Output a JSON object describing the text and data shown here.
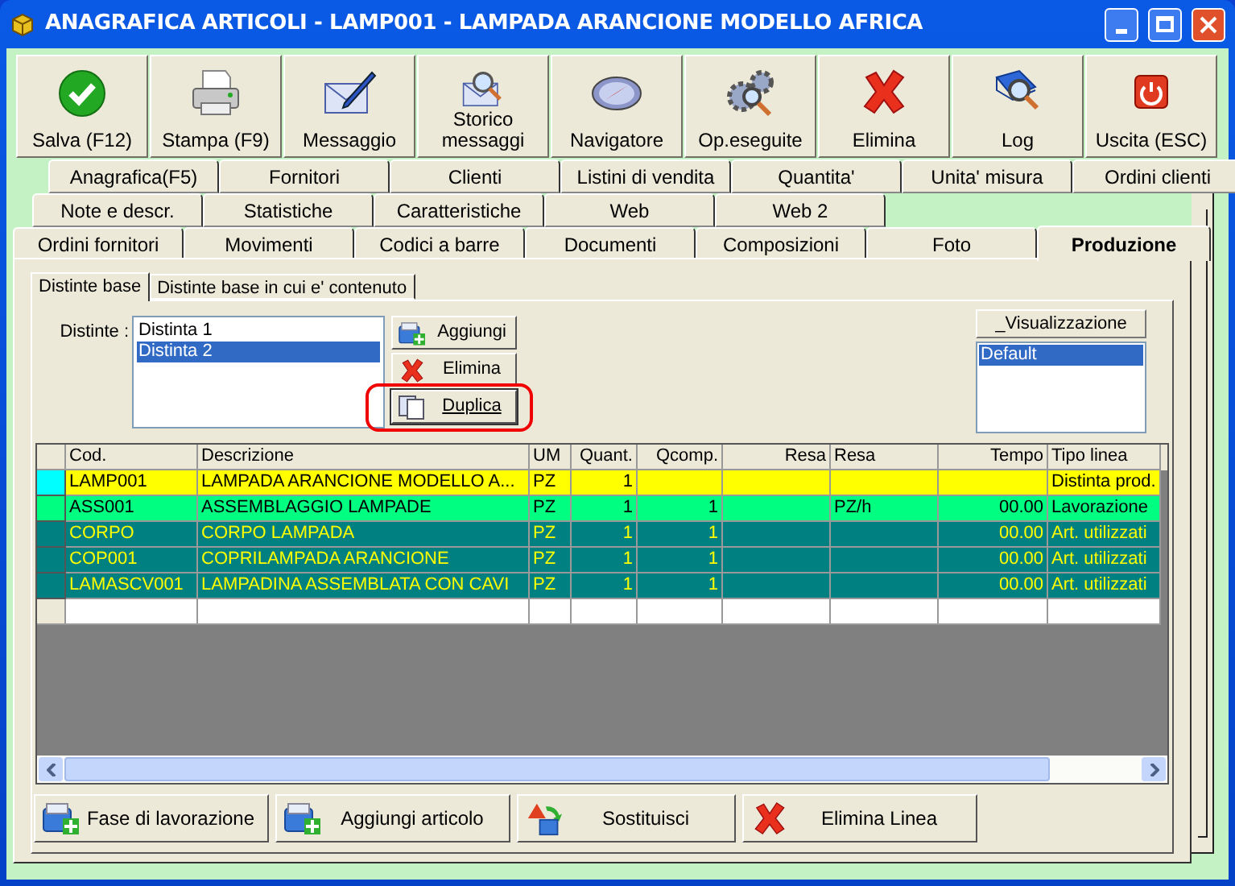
{
  "window": {
    "title": "ANAGRAFICA ARTICOLI - LAMP001 - LAMPADA ARANCIONE MODELLO AFRICA"
  },
  "toolbar": [
    {
      "kind": "check",
      "label": "Salva (F12)"
    },
    {
      "kind": "printer",
      "label": "Stampa (F9)"
    },
    {
      "kind": "pen",
      "label": "Messaggio"
    },
    {
      "kind": "history",
      "label": "Storico messaggi"
    },
    {
      "kind": "compass",
      "label": "Navigatore"
    },
    {
      "kind": "gears",
      "label": "Op.eseguite"
    },
    {
      "kind": "delete",
      "label": "Elimina"
    },
    {
      "kind": "log",
      "label": "Log"
    },
    {
      "kind": "power",
      "label": "Uscita (ESC)"
    }
  ],
  "tab_rows": [
    [
      {
        "label": "Anagrafica(F5)",
        "selected": false
      },
      {
        "label": "Fornitori",
        "selected": false
      },
      {
        "label": "Clienti",
        "selected": false
      },
      {
        "label": "Listini di vendita",
        "selected": false
      },
      {
        "label": "Quantita'",
        "selected": false
      },
      {
        "label": "Unita' misura",
        "selected": false
      },
      {
        "label": "Ordini clienti",
        "selected": false
      }
    ],
    [
      {
        "label": "Note e descr.",
        "selected": false
      },
      {
        "label": "Statistiche",
        "selected": false
      },
      {
        "label": "Caratteristiche",
        "selected": false
      },
      {
        "label": "Web",
        "selected": false
      },
      {
        "label": "Web 2",
        "selected": false
      }
    ],
    [
      {
        "label": "Ordini fornitori",
        "selected": false
      },
      {
        "label": "Movimenti",
        "selected": false
      },
      {
        "label": "Codici a barre",
        "selected": false
      },
      {
        "label": "Documenti",
        "selected": false
      },
      {
        "label": "Composizioni",
        "selected": false
      },
      {
        "label": "Foto",
        "selected": false
      },
      {
        "label": "Produzione",
        "selected": true
      }
    ]
  ],
  "sub_tabs": [
    {
      "label": "Distinte base",
      "selected": true
    },
    {
      "label": "Distinte base in cui e' contenuto",
      "selected": false
    }
  ],
  "distinte": {
    "label": "Distinte :",
    "items": [
      {
        "label": "Distinta 1",
        "selected": false
      },
      {
        "label": "Distinta 2",
        "selected": true
      }
    ]
  },
  "distinte_buttons": [
    {
      "kind": "add",
      "label": "Aggiungi",
      "highlighted": false
    },
    {
      "kind": "delete",
      "label": "Elimina",
      "highlighted": false
    },
    {
      "kind": "copy",
      "label": "Duplica",
      "highlighted": true
    }
  ],
  "visualizzazione": {
    "header": "_Visualizzazione",
    "items": [
      {
        "label": "Default",
        "selected": true
      }
    ]
  },
  "table": {
    "columns": [
      "Cod.",
      "Descrizione",
      "UM",
      "Quant.",
      "Qcomp.",
      "Resa",
      "Resa",
      "Tempo",
      "Tipo linea"
    ],
    "rows": [
      {
        "kind": "product",
        "selected": true,
        "cells": [
          "LAMP001",
          "LAMPADA ARANCIONE MODELLO A...",
          "PZ",
          "1",
          "",
          "",
          "",
          "",
          "Distinta prod."
        ]
      },
      {
        "kind": "operation",
        "selected": false,
        "cells": [
          "ASS001",
          "ASSEMBLAGGIO LAMPADE",
          "PZ",
          "1",
          "1",
          "",
          "PZ/h",
          "00.00",
          "Lavorazione"
        ]
      },
      {
        "kind": "component",
        "selected": false,
        "cells": [
          "CORPO",
          "CORPO LAMPADA",
          "PZ",
          "1",
          "1",
          "",
          "",
          "00.00",
          "Art. utilizzati"
        ]
      },
      {
        "kind": "component",
        "selected": false,
        "cells": [
          "COP001",
          "COPRILAMPADA ARANCIONE",
          "PZ",
          "1",
          "1",
          "",
          "",
          "00.00",
          "Art. utilizzati"
        ]
      },
      {
        "kind": "component",
        "selected": false,
        "cells": [
          "LAMASCV001",
          "LAMPADINA ASSEMBLATA CON CAVI",
          "PZ",
          "1",
          "1",
          "",
          "",
          "00.00",
          "Art. utilizzati"
        ]
      }
    ]
  },
  "bottom_buttons": [
    {
      "kind": "add",
      "label": "Fase di lavorazione"
    },
    {
      "kind": "add",
      "label": "Aggiungi articolo"
    },
    {
      "kind": "swap",
      "label": "Sostituisci"
    },
    {
      "kind": "delete",
      "label": "Elimina Linea"
    }
  ]
}
